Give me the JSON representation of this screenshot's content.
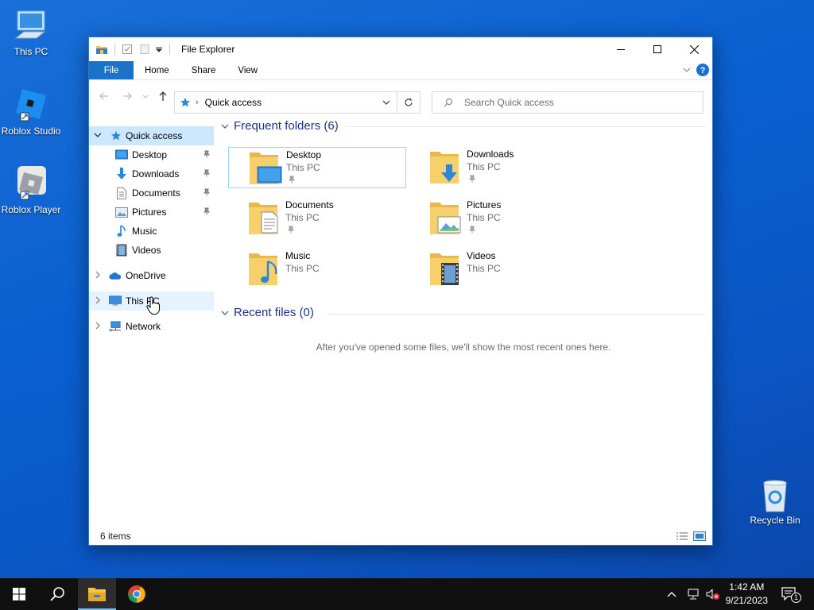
{
  "desktop": {
    "icons": [
      {
        "label": "This PC",
        "icon": "this-pc-icon"
      },
      {
        "label": "Roblox Studio",
        "icon": "roblox-studio-icon"
      },
      {
        "label": "Roblox Player",
        "icon": "roblox-player-icon"
      },
      {
        "label": "Recycle Bin",
        "icon": "recycle-bin-icon"
      }
    ]
  },
  "window": {
    "title": "File Explorer",
    "ribbon_tabs": [
      "File",
      "Home",
      "Share",
      "View"
    ],
    "address": "Quick access",
    "search_placeholder": "Search Quick access",
    "nav": {
      "quick_access": "Quick access",
      "pinned": [
        {
          "label": "Desktop",
          "icon": "desktop-icon",
          "pinned": true
        },
        {
          "label": "Downloads",
          "icon": "downloads-icon",
          "pinned": true
        },
        {
          "label": "Documents",
          "icon": "documents-icon",
          "pinned": true
        },
        {
          "label": "Pictures",
          "icon": "pictures-icon",
          "pinned": true
        },
        {
          "label": "Music",
          "icon": "music-icon",
          "pinned": false
        },
        {
          "label": "Videos",
          "icon": "videos-icon",
          "pinned": false
        }
      ],
      "onedrive": "OneDrive",
      "this_pc": "This PC",
      "network": "Network"
    },
    "frequent_header": "Frequent folders (6)",
    "frequent": [
      {
        "name": "Desktop",
        "location": "This PC",
        "pinned": true
      },
      {
        "name": "Downloads",
        "location": "This PC",
        "pinned": true
      },
      {
        "name": "Documents",
        "location": "This PC",
        "pinned": true
      },
      {
        "name": "Pictures",
        "location": "This PC",
        "pinned": true
      },
      {
        "name": "Music",
        "location": "This PC",
        "pinned": false
      },
      {
        "name": "Videos",
        "location": "This PC",
        "pinned": false
      }
    ],
    "recent_header": "Recent files (0)",
    "recent_empty": "After you've opened some files, we'll show the most recent ones here.",
    "status": "6 items"
  },
  "taskbar": {
    "time": "1:42 AM",
    "date": "9/21/2023",
    "notification_count": "1"
  },
  "colors": {
    "accent": "#1a73c8",
    "selection": "#cce8ff",
    "group_header": "#1e3287"
  }
}
